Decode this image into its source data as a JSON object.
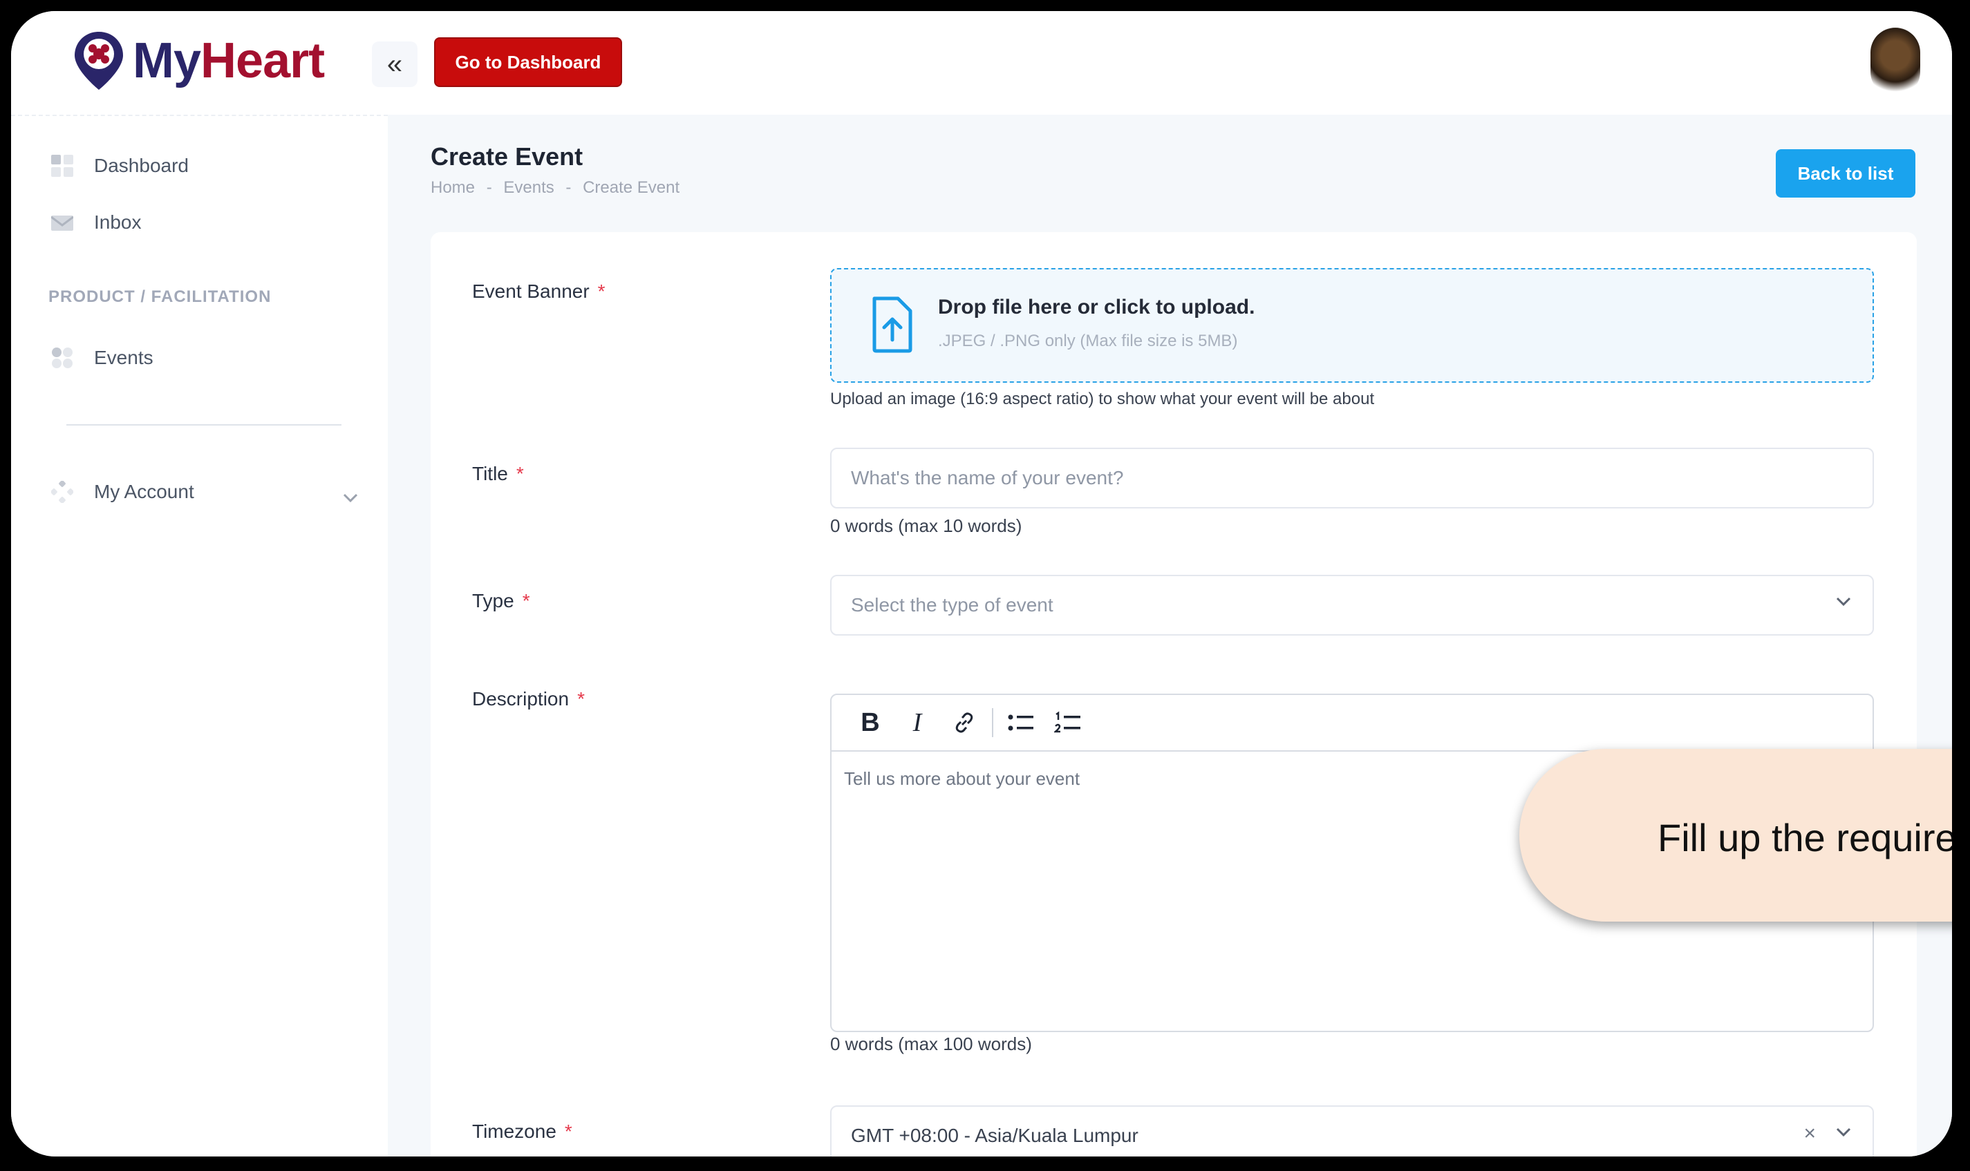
{
  "app": {
    "logo_text_my": "My",
    "logo_text_heart": "Heart"
  },
  "topbar": {
    "go_dashboard_label": "Go to Dashboard",
    "collapse_glyph": "«"
  },
  "sidebar": {
    "items": [
      {
        "label": "Dashboard",
        "icon": "dashboard-icon"
      },
      {
        "label": "Inbox",
        "icon": "inbox-icon"
      }
    ],
    "section_heading": "PRODUCT / FACILITATION",
    "section_items": [
      {
        "label": "Events",
        "icon": "events-icon"
      }
    ],
    "account": {
      "label": "My Account",
      "icon": "account-icon"
    }
  },
  "page": {
    "title": "Create Event",
    "breadcrumb": [
      "Home",
      "-",
      "Events",
      "-",
      "Create Event"
    ],
    "back_label": "Back to list"
  },
  "form": {
    "banner": {
      "label": "Event Banner",
      "required": "*",
      "drop_title": "Drop file here or click to upload.",
      "drop_sub": ".JPEG / .PNG only (Max file size is 5MB)",
      "hint": "Upload an image (16:9 aspect ratio) to show what your event will be about"
    },
    "title": {
      "label": "Title",
      "required": "*",
      "placeholder": "What's the name of your event?",
      "counter": "0 words (max 10 words)"
    },
    "type": {
      "label": "Type",
      "required": "*",
      "placeholder": "Select the type of event"
    },
    "description": {
      "label": "Description",
      "required": "*",
      "placeholder": "Tell us more about your event",
      "counter": "0 words (max 100 words)",
      "toolbar": {
        "bold": "B",
        "italic": "I"
      }
    },
    "timezone": {
      "label": "Timezone",
      "required": "*",
      "value": "GMT +08:00 - Asia/Kuala Lumpur",
      "clear_glyph": "×"
    }
  },
  "callout": {
    "text": "Fill up the required"
  },
  "colors": {
    "brand_red": "#c80c0c",
    "accent_blue": "#1aa3ee",
    "logo_navy": "#2a2569",
    "logo_red": "#a3102f"
  }
}
